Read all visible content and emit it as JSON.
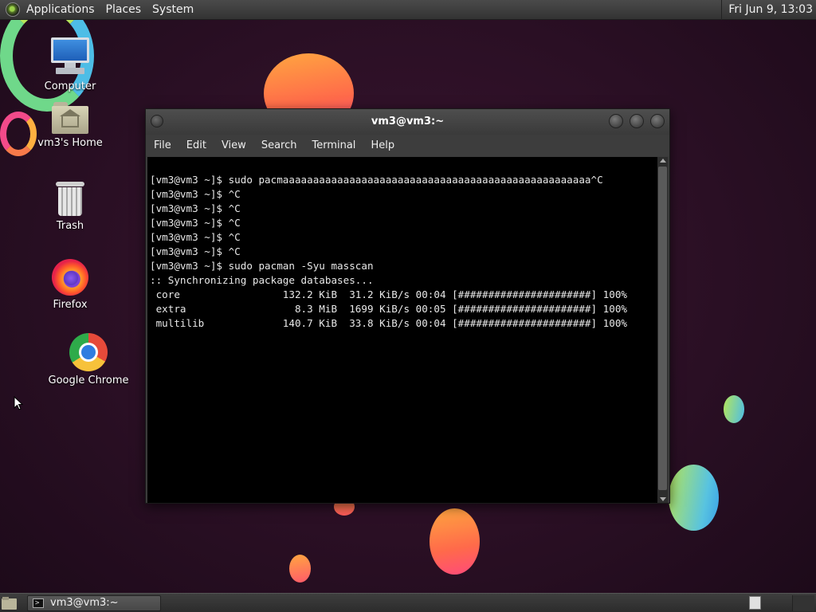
{
  "top_panel": {
    "menu": [
      "Applications",
      "Places",
      "System"
    ],
    "clock": "Fri Jun  9, 13:03"
  },
  "desktop": {
    "icons": [
      {
        "label": "Computer",
        "icon": "computer-icon"
      },
      {
        "label": "vm3's Home",
        "icon": "home-folder-icon"
      },
      {
        "label": "Trash",
        "icon": "trash-icon"
      },
      {
        "label": "Firefox",
        "icon": "firefox-icon"
      },
      {
        "label": "Google Chrome",
        "icon": "chrome-icon"
      }
    ]
  },
  "terminal": {
    "title": "vm3@vm3:~",
    "menu": [
      "File",
      "Edit",
      "View",
      "Search",
      "Terminal",
      "Help"
    ],
    "lines": [
      "[vm3@vm3 ~]$ sudo pacmaaaaaaaaaaaaaaaaaaaaaaaaaaaaaaaaaaaaaaaaaaaaaaaaaaa^C",
      "[vm3@vm3 ~]$ ^C",
      "[vm3@vm3 ~]$ ^C",
      "[vm3@vm3 ~]$ ^C",
      "[vm3@vm3 ~]$ ^C",
      "[vm3@vm3 ~]$ ^C",
      "[vm3@vm3 ~]$ sudo pacman -Syu masscan",
      ":: Synchronizing package databases...",
      " core                 132.2 KiB  31.2 KiB/s 00:04 [######################] 100%",
      " extra                  8.3 MiB  1699 KiB/s 00:05 [######################] 100%",
      " multilib             140.7 KiB  33.8 KiB/s 00:04 [######################] 100%"
    ]
  },
  "taskbar": {
    "tasks": [
      {
        "label": "vm3@vm3:~",
        "icon": "terminal-icon"
      }
    ]
  }
}
